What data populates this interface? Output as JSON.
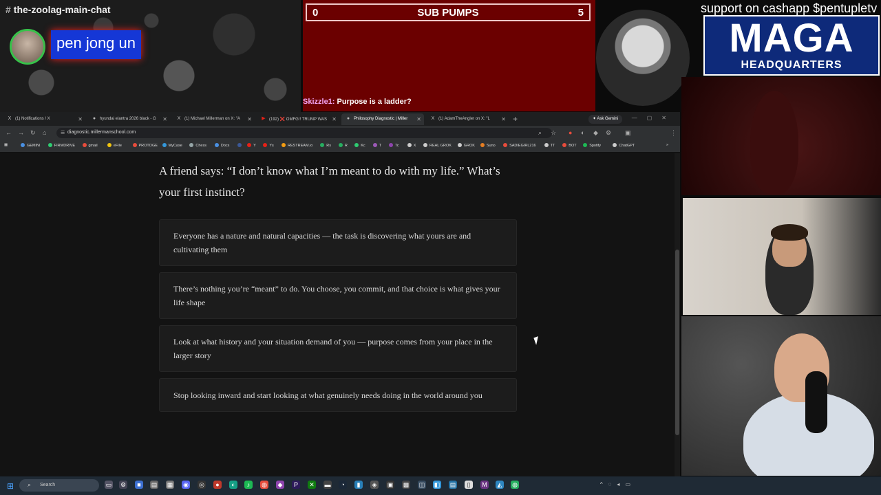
{
  "overlay": {
    "channel": "the-zoolag-main-chat",
    "speaker": "pen jong un"
  },
  "scoreboard": {
    "left_score": "0",
    "title": "SUB PUMPS",
    "right_score": "5"
  },
  "chat": {
    "user": "Skizzle1:",
    "message": "Purpose is a ladder?"
  },
  "support_text": "support on cashapp $pentupletv",
  "logo": {
    "line1": "MAGA",
    "line2": "HEADQUARTERS"
  },
  "browser": {
    "tabs": [
      {
        "icon": "X",
        "label": "(1) Notifications / X"
      },
      {
        "icon": "●",
        "label": "hyundai elantra 2026 black - G"
      },
      {
        "icon": "X",
        "label": "(1) Michael Millerman on X: \"A"
      },
      {
        "icon": "▶",
        "label": "(192) ❌ OMFG!! TRUMP WAS"
      },
      {
        "icon": "●",
        "label": "Philosophy Diagnostic | Miller"
      },
      {
        "icon": "X",
        "label": "(1) AdamTheAngler on X: \"L"
      }
    ],
    "ask_gemini": "Ask Gemini",
    "url": "diagnostic.millermanschool.com",
    "bookmarks": [
      {
        "label": "GEMINI",
        "color": "#4a90e2"
      },
      {
        "label": "FIRMDRIVE",
        "color": "#2ecc71"
      },
      {
        "label": "gmail",
        "color": "#e74c3c"
      },
      {
        "label": "eFile",
        "color": "#f1c40f"
      },
      {
        "label": "PROTOGE",
        "color": "#e74c3c"
      },
      {
        "label": "MyCase",
        "color": "#3498db"
      },
      {
        "label": "Chess",
        "color": "#95a5a6"
      },
      {
        "label": "Docs",
        "color": "#4a90e2"
      },
      {
        "label": "",
        "color": "#3b5998"
      },
      {
        "label": "Y",
        "color": "#e62117"
      },
      {
        "label": "Ys",
        "color": "#e62117"
      },
      {
        "label": "RESTREAM.io",
        "color": "#f39c12"
      },
      {
        "label": "Rs",
        "color": "#27ae60"
      },
      {
        "label": "R",
        "color": "#27ae60"
      },
      {
        "label": "Kc",
        "color": "#2ecc71"
      },
      {
        "label": "T",
        "color": "#9b59b6"
      },
      {
        "label": "Tc",
        "color": "#8e44ad"
      },
      {
        "label": "X",
        "color": "#cccccc"
      },
      {
        "label": "REAL GROK",
        "color": "#cccccc"
      },
      {
        "label": "GROK",
        "color": "#cccccc"
      },
      {
        "label": "Suno",
        "color": "#e67e22"
      },
      {
        "label": "SADIEGIRL216",
        "color": "#e74c3c"
      },
      {
        "label": "TT",
        "color": "#cccccc"
      },
      {
        "label": "BOT",
        "color": "#e74c3c"
      },
      {
        "label": "Spotify",
        "color": "#1db954"
      },
      {
        "label": "ChatGPT",
        "color": "#cccccc"
      }
    ]
  },
  "quiz": {
    "question": "A friend says: “I don’t know what I’m meant to do with my life.” What’s your first instinct?",
    "options": [
      "Everyone has a nature and natural capacities — the task is discovering what yours are and cultivating them",
      "There’s nothing you’re “meant” to do. You choose, you commit, and that choice is what gives your life shape",
      "Look at what history and your situation demand of you — purpose comes from your place in the larger story",
      "Stop looking inward and start looking at what genuinely needs doing in the world around you"
    ]
  },
  "taskbar": {
    "search_placeholder": "Search"
  }
}
